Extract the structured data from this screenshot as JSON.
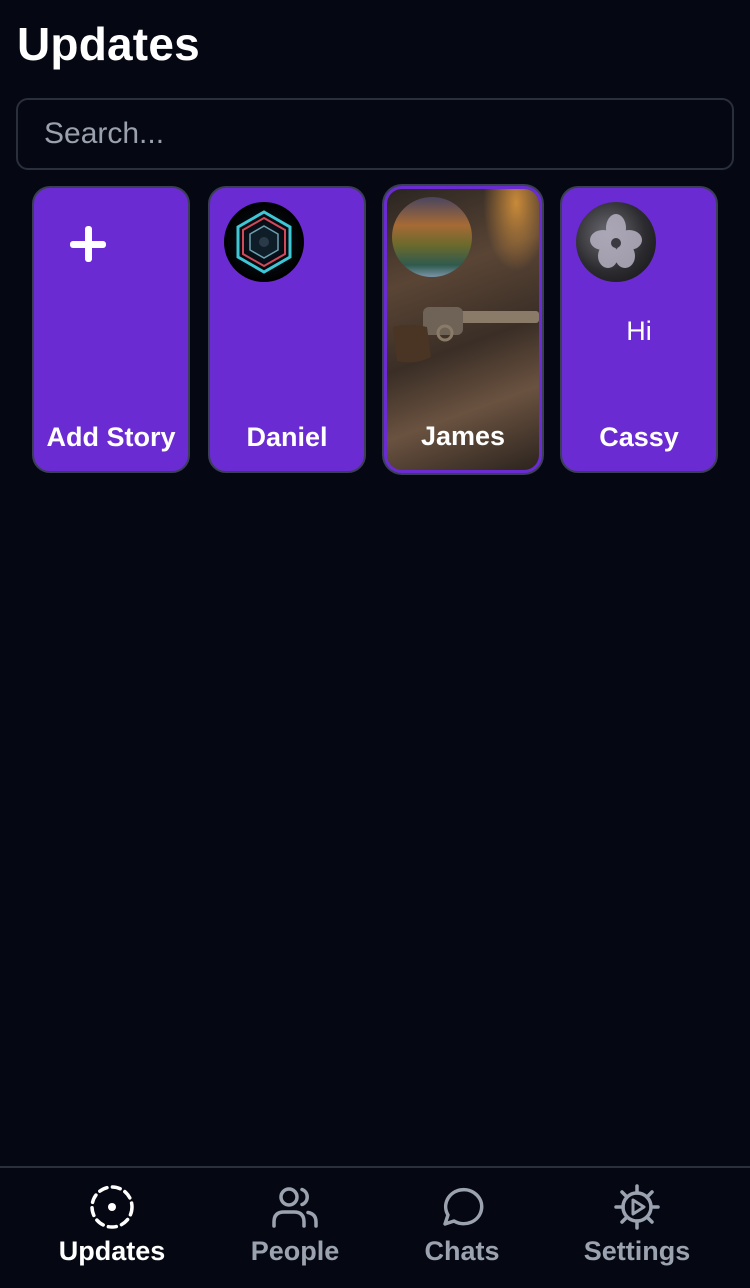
{
  "header": {
    "title": "Updates"
  },
  "search": {
    "placeholder": "Search..."
  },
  "stories": [
    {
      "label": "Add Story",
      "icon": "plus-icon"
    },
    {
      "label": "Daniel",
      "avatar": "hexagon-avatar"
    },
    {
      "label": "James",
      "avatar": "landscape-avatar"
    },
    {
      "label": "Cassy",
      "avatar": "flower-avatar",
      "text": "Hi"
    }
  ],
  "nav": {
    "items": [
      {
        "label": "Updates",
        "icon": "updates-icon",
        "active": true
      },
      {
        "label": "People",
        "icon": "people-icon",
        "active": false
      },
      {
        "label": "Chats",
        "icon": "chat-bubble-icon",
        "active": false
      },
      {
        "label": "Settings",
        "icon": "gear-icon",
        "active": false
      }
    ]
  },
  "colors": {
    "background": "#050812",
    "accent": "#6a2bd3",
    "border": "#2a2f3d",
    "inactive_text": "#9ca3b0"
  }
}
